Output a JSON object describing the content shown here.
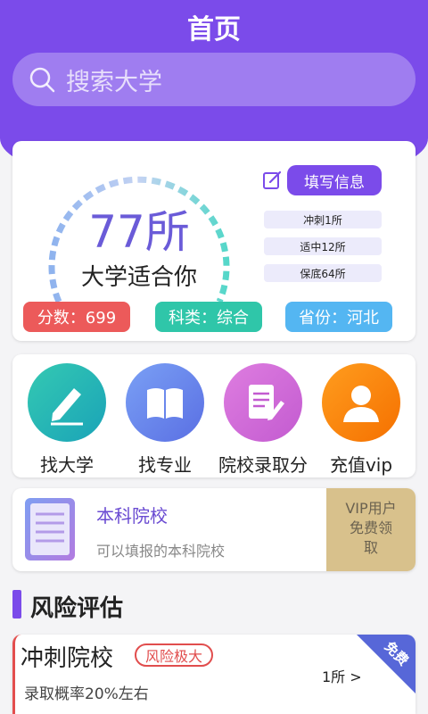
{
  "header": {
    "title": "首页"
  },
  "search": {
    "placeholder": "搜索大学"
  },
  "summary": {
    "count": "77所",
    "fit_label": "大学适合你",
    "fill_button": "填写信息",
    "tiers": [
      "冲刺1所",
      "适中12所",
      "保底64所"
    ],
    "score": "分数：699",
    "subject": "科类：综合",
    "province": "省份：河北"
  },
  "quick": [
    {
      "label": "找大学",
      "icon": "pencil-icon",
      "color": "#20b7a8"
    },
    {
      "label": "找专业",
      "icon": "book-icon",
      "color": "#6b8df0"
    },
    {
      "label": "院校录取分",
      "icon": "document-pen-icon",
      "color": "#d46ad6"
    },
    {
      "label": "充值vip",
      "icon": "user-icon",
      "color": "#f57c12"
    }
  ],
  "school": {
    "title": "本科院校",
    "subtitle": "可以填报的本科院校",
    "vip_lines": [
      "VIP用户",
      "免费领",
      "取"
    ]
  },
  "risk_section": {
    "title": "风险评估"
  },
  "risk_item": {
    "title": "冲刺院校",
    "badge": "风险极大",
    "count": "1所 >",
    "probability": "录取概率20%左右",
    "ribbon": "免费"
  },
  "colors": {
    "brand": "#7b4bea",
    "score_pill": "#ec5a5a",
    "subject_pill": "#2fc6a9",
    "province_pill": "#54b6f2",
    "vip_gold": "#d8c18c"
  }
}
